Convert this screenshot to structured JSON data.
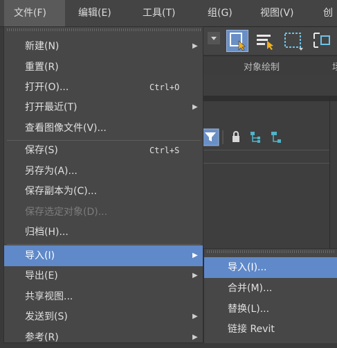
{
  "menubar": {
    "items": [
      {
        "label": "文件(F)"
      },
      {
        "label": "编辑(E)"
      },
      {
        "label": "工具(T)"
      },
      {
        "label": "组(G)"
      },
      {
        "label": "视图(V)"
      },
      {
        "label": "创"
      }
    ]
  },
  "background": {
    "ribbon_label": "对象绘制",
    "ribbon_label2": "场"
  },
  "file_menu": {
    "items": [
      {
        "label": "新建(N)",
        "submenu": true
      },
      {
        "label": "重置(R)"
      },
      {
        "label": "打开(O)...",
        "shortcut": "Ctrl+O"
      },
      {
        "label": "打开最近(T)",
        "submenu": true
      },
      {
        "label": "查看图像文件(V)..."
      },
      {
        "label": "保存(S)",
        "shortcut": "Ctrl+S"
      },
      {
        "label": "另存为(A)..."
      },
      {
        "label": "保存副本为(C)..."
      },
      {
        "label": "保存选定对象(D)...",
        "disabled": true
      },
      {
        "label": "归档(H)..."
      },
      {
        "label": "导入(I)",
        "submenu": true,
        "highlighted": true
      },
      {
        "label": "导出(E)",
        "submenu": true
      },
      {
        "label": "共享视图..."
      },
      {
        "label": "发送到(S)",
        "submenu": true
      },
      {
        "label": "参考(R)",
        "submenu": true
      }
    ]
  },
  "import_submenu": {
    "items": [
      {
        "label": "导入(I)...",
        "highlighted": true
      },
      {
        "label": "合并(M)..."
      },
      {
        "label": "替换(L)..."
      },
      {
        "label": "链接 Revit"
      }
    ]
  },
  "colors": {
    "highlight": "#5f89c9",
    "menu_bg": "#474747",
    "toolbar_selected": "#6a8fc6",
    "icon_accent": "#4fb3c9"
  }
}
